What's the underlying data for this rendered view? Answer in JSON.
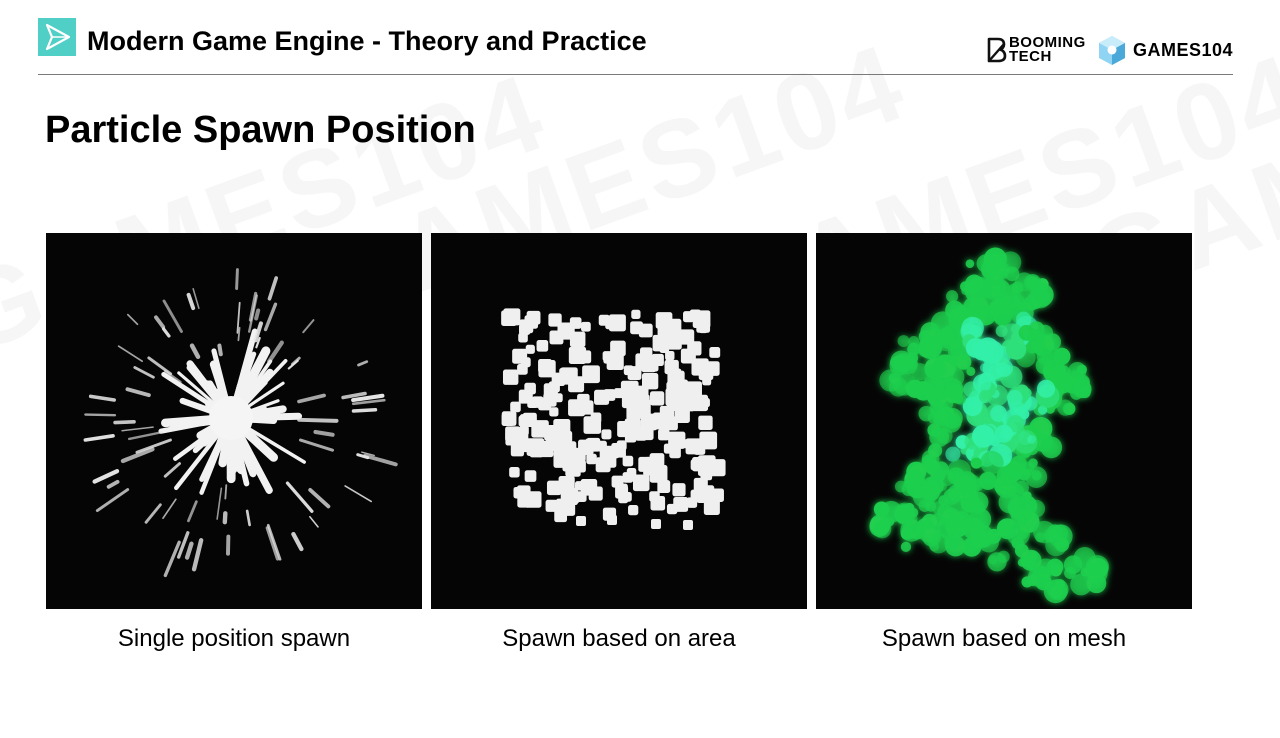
{
  "header": {
    "course_title": "Modern Game Engine - Theory and Practice",
    "brand_booming": "BOOMING TECH",
    "brand_games": "GAMES104"
  },
  "slide": {
    "title": "Particle Spawn Position"
  },
  "examples": [
    {
      "caption": "Single position spawn",
      "image": "radial-burst-particles",
      "color": "#ffffff"
    },
    {
      "caption": "Spawn based on area",
      "image": "square-area-particles",
      "color": "#ffffff"
    },
    {
      "caption": "Spawn based on mesh",
      "image": "green-mesh-particles",
      "color": "#2ef07a"
    }
  ],
  "colors": {
    "accent": "#4fcfc6",
    "panel_bg": "#050505",
    "divider": "#7a7a7a"
  }
}
